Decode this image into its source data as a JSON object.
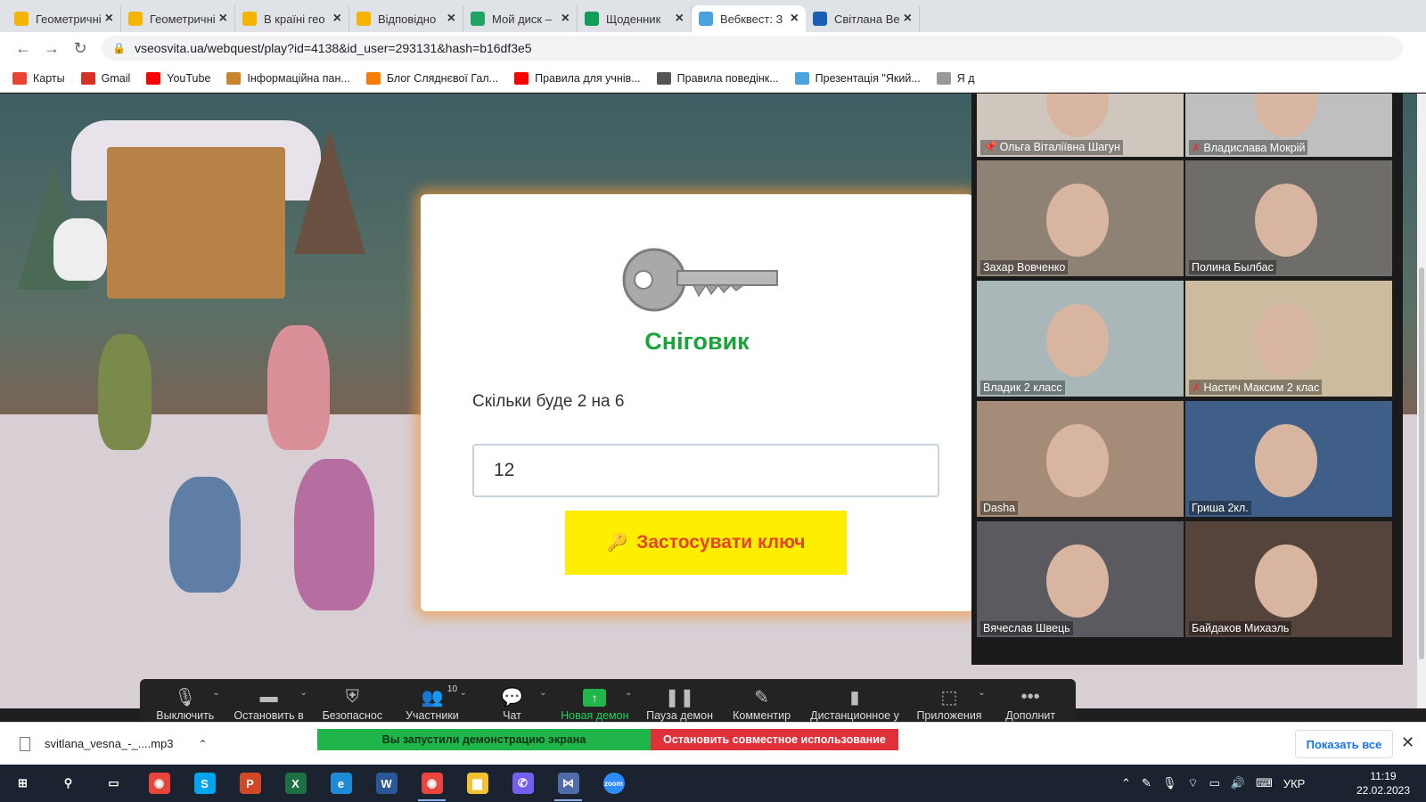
{
  "browser": {
    "tabs": [
      {
        "title": "Геометричні",
        "icon": "slides-icon",
        "active": false
      },
      {
        "title": "Геометричні",
        "icon": "slides-icon",
        "active": false
      },
      {
        "title": "В країні гео",
        "icon": "slides-icon",
        "active": false
      },
      {
        "title": "Відповідно",
        "icon": "slides-icon",
        "active": false
      },
      {
        "title": "Мой диск –",
        "icon": "drive-icon",
        "active": false
      },
      {
        "title": "Щоденник",
        "icon": "sheets-icon",
        "active": false
      },
      {
        "title": "Вебквест: З",
        "icon": "snowflake-icon",
        "active": true
      },
      {
        "title": "Світлана Ве",
        "icon": "globe-icon",
        "active": false
      }
    ],
    "url": "vseosvita.ua/webquest/play?id=4138&id_user=293131&hash=b16df3e5",
    "bookmarks": [
      {
        "label": "Карты",
        "icon": "maps-pin-icon",
        "color": "#ea4335"
      },
      {
        "label": "Gmail",
        "icon": "gmail-icon",
        "color": "#d93025"
      },
      {
        "label": "YouTube",
        "icon": "youtube-icon",
        "color": "#ff0000"
      },
      {
        "label": "Інформаційна пан...",
        "icon": "bookmark-image-icon",
        "color": "#c8862c"
      },
      {
        "label": "Блог Сляднєвої Гал...",
        "icon": "blogger-icon",
        "color": "#f57d00"
      },
      {
        "label": "Правила для учнів...",
        "icon": "youtube-icon",
        "color": "#ff0000"
      },
      {
        "label": "Правила поведінк...",
        "icon": "printer-icon",
        "color": "#555555"
      },
      {
        "label": "Презентація \"Який...",
        "icon": "snowflake-icon",
        "color": "#4aa3df"
      },
      {
        "label": "Я д",
        "icon": "book-icon",
        "color": "#999999"
      }
    ]
  },
  "quest": {
    "title": "Сніговик",
    "question": "Скільки буде 2 на 6",
    "answer": "12",
    "apply_label": "Застосувати ключ",
    "colors": {
      "title": "#1ba33b",
      "button": "#ffee00",
      "button_text": "#e2442a"
    }
  },
  "zoom": {
    "participants": [
      {
        "name": "Ольга Віталіївна Шагун",
        "pinned": true,
        "muted": false,
        "speaker": true,
        "bg": "#cfc7bd"
      },
      {
        "name": "Владислава Мокрій",
        "pinned": false,
        "muted": true,
        "speaker": false,
        "bg": "#bfbfbf"
      },
      {
        "name": "Захар Вовченко",
        "pinned": false,
        "muted": false,
        "speaker": false,
        "bg": "#8e8275"
      },
      {
        "name": "Полина Былбас",
        "pinned": false,
        "muted": false,
        "speaker": false,
        "bg": "#6f6d6a"
      },
      {
        "name": "Владик 2 класс",
        "pinned": false,
        "muted": false,
        "speaker": false,
        "bg": "#a9b7b8"
      },
      {
        "name": "Настич Максим 2 клас",
        "pinned": false,
        "muted": true,
        "speaker": false,
        "bg": "#cdbba0"
      },
      {
        "name": "Dasha",
        "pinned": false,
        "muted": false,
        "speaker": false,
        "bg": "#a58c78"
      },
      {
        "name": "Гриша 2кл.",
        "pinned": false,
        "muted": false,
        "speaker": false,
        "bg": "#3f5f88"
      },
      {
        "name": "Вячеслав Швець",
        "pinned": false,
        "muted": false,
        "speaker": false,
        "bg": "#5b5a60"
      },
      {
        "name": "Байдаков Михаэль",
        "pinned": false,
        "muted": false,
        "speaker": false,
        "bg": "#55443c"
      }
    ],
    "controls": [
      {
        "label": "Выключить",
        "icon": "microphone-icon",
        "glyph": "🎙",
        "caret": true
      },
      {
        "label": "Остановить в",
        "icon": "video-camera-icon",
        "glyph": "▬",
        "caret": true
      },
      {
        "label": "Безопаснос",
        "icon": "shield-icon",
        "glyph": "⛨",
        "caret": false
      },
      {
        "label": "Участники",
        "icon": "participants-icon",
        "glyph": "👥",
        "caret": true,
        "badge": "10"
      },
      {
        "label": "Чат",
        "icon": "chat-icon",
        "glyph": "💬",
        "caret": true
      },
      {
        "label": "Новая демон",
        "icon": "share-screen-icon",
        "glyph": "↑",
        "caret": true,
        "share": true
      },
      {
        "label": "Пауза демон",
        "icon": "pause-icon",
        "glyph": "❚❚",
        "caret": false
      },
      {
        "label": "Комментир",
        "icon": "pencil-icon",
        "glyph": "✎",
        "caret": false
      },
      {
        "label": "Дистанционное у",
        "icon": "mouse-icon",
        "glyph": "▮",
        "caret": false
      },
      {
        "label": "Приложения",
        "icon": "apps-icon",
        "glyph": "⬚",
        "caret": true
      },
      {
        "label": "Дополнит",
        "icon": "more-icon",
        "glyph": "•••",
        "caret": false
      }
    ],
    "share_banner": "Вы запустили демонстрацию экрана",
    "stop_share": "Остановить совместное использование"
  },
  "downloads": {
    "file": "svitlana_vesna_-_....mp3",
    "show_all": "Показать все"
  },
  "taskbar": {
    "apps": [
      {
        "icon": "windows-start-icon",
        "glyph": "⊞",
        "color": "#ffffff",
        "running": false
      },
      {
        "icon": "search-icon",
        "glyph": "⚲",
        "color": "#ffffff",
        "running": false
      },
      {
        "icon": "task-view-icon",
        "glyph": "▭",
        "color": "#ffffff",
        "running": false
      },
      {
        "icon": "chrome-icon",
        "glyph": "◉",
        "color": "#e8453c",
        "running": false
      },
      {
        "icon": "skype-icon",
        "glyph": "S",
        "color": "#00a4ef",
        "running": false
      },
      {
        "icon": "powerpoint-icon",
        "glyph": "P",
        "color": "#d24726",
        "running": false
      },
      {
        "icon": "excel-icon",
        "glyph": "X",
        "color": "#1d7044",
        "running": false
      },
      {
        "icon": "edge-icon",
        "glyph": "e",
        "color": "#1f8ad6",
        "running": false
      },
      {
        "icon": "word-icon",
        "glyph": "W",
        "color": "#2b5797",
        "running": false
      },
      {
        "icon": "chrome-icon",
        "glyph": "◉",
        "color": "#e8453c",
        "running": true
      },
      {
        "icon": "file-explorer-icon",
        "glyph": "▆",
        "color": "#f2c232",
        "running": false
      },
      {
        "icon": "viber-icon",
        "glyph": "✆",
        "color": "#7360f2",
        "running": false
      },
      {
        "icon": "zoom-share-icon",
        "glyph": "⋈",
        "color": "#4f6ba8",
        "running": true
      },
      {
        "icon": "zoom-icon",
        "glyph": "zoom",
        "color": "#2d8cff",
        "running": false
      }
    ],
    "lang": "УКР",
    "time": "11:19",
    "date": "22.02.2023"
  }
}
